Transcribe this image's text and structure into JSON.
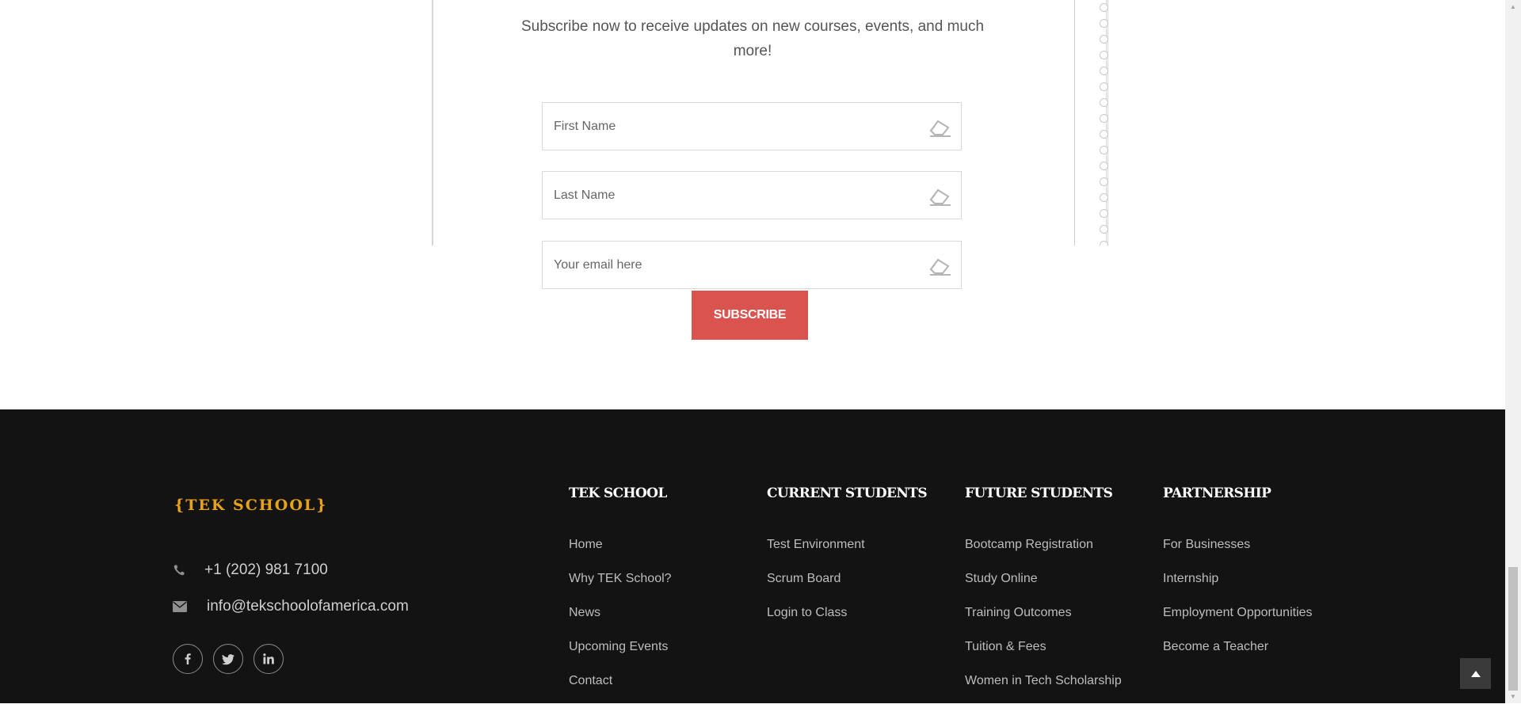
{
  "newsletter": {
    "description": "Subscribe now to receive updates on new courses, events, and much more!",
    "first_name_placeholder": "First Name",
    "last_name_placeholder": "Last Name",
    "email_placeholder": "Your email here",
    "subscribe_label": "SUBSCRIBE",
    "button_color": "#d9534f"
  },
  "footer": {
    "logo_text": "{TEK SCHOOL}",
    "logo_color": "#e8a21a",
    "phone": "+1 (202) 981 7100",
    "email": "info@tekschoolofamerica.com",
    "socials": [
      "facebook-icon",
      "twitter-icon",
      "linkedin-icon"
    ],
    "columns": [
      {
        "title": "TEK SCHOOL",
        "links": [
          "Home",
          "Why TEK School?",
          "News",
          "Upcoming Events",
          "Contact"
        ]
      },
      {
        "title": "CURRENT STUDENTS",
        "links": [
          "Test Environment",
          "Scrum Board",
          "Login to Class"
        ]
      },
      {
        "title": "FUTURE STUDENTS",
        "links": [
          "Bootcamp Registration",
          "Study Online",
          "Training Outcomes",
          "Tuition & Fees",
          "Women in Tech Scholarship"
        ]
      },
      {
        "title": "PARTNERSHIP",
        "links": [
          "For Businesses",
          "Internship",
          "Employment Opportunities",
          "Become a Teacher"
        ]
      }
    ],
    "background": "#131313"
  }
}
